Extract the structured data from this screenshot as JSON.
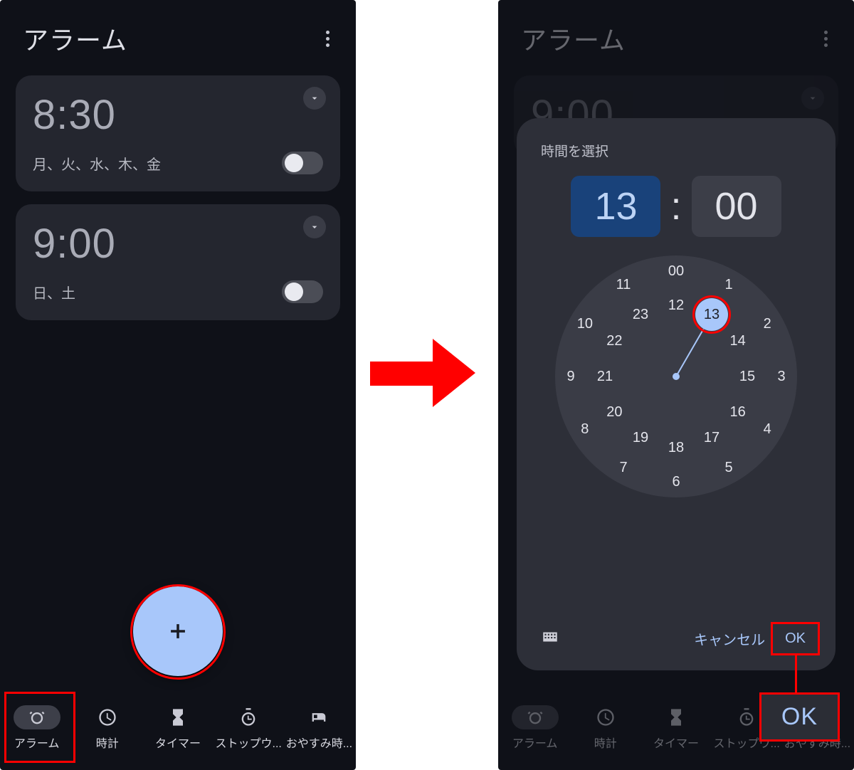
{
  "header": {
    "title": "アラーム"
  },
  "alarms": [
    {
      "time": "8:30",
      "days": "月、火、水、木、金"
    },
    {
      "time": "9:00",
      "days": "日、土"
    }
  ],
  "nav": {
    "items": [
      {
        "label": "アラーム"
      },
      {
        "label": "時計"
      },
      {
        "label": "タイマー"
      },
      {
        "label": "ストップウ..."
      },
      {
        "label": "おやすみ時..."
      }
    ]
  },
  "dialog": {
    "title": "時間を選択",
    "hour": "13",
    "minute": "00",
    "cancel": "キャンセル",
    "ok": "OK",
    "outer_hours": [
      "00",
      "1",
      "2",
      "3",
      "4",
      "5",
      "6",
      "7",
      "8",
      "9",
      "10",
      "11"
    ],
    "inner_hours": [
      "12",
      "13",
      "14",
      "15",
      "16",
      "17",
      "18",
      "19",
      "20",
      "21",
      "22",
      "23"
    ],
    "selected_inner_index": 1
  },
  "annotations": {
    "big_ok": "OK"
  }
}
